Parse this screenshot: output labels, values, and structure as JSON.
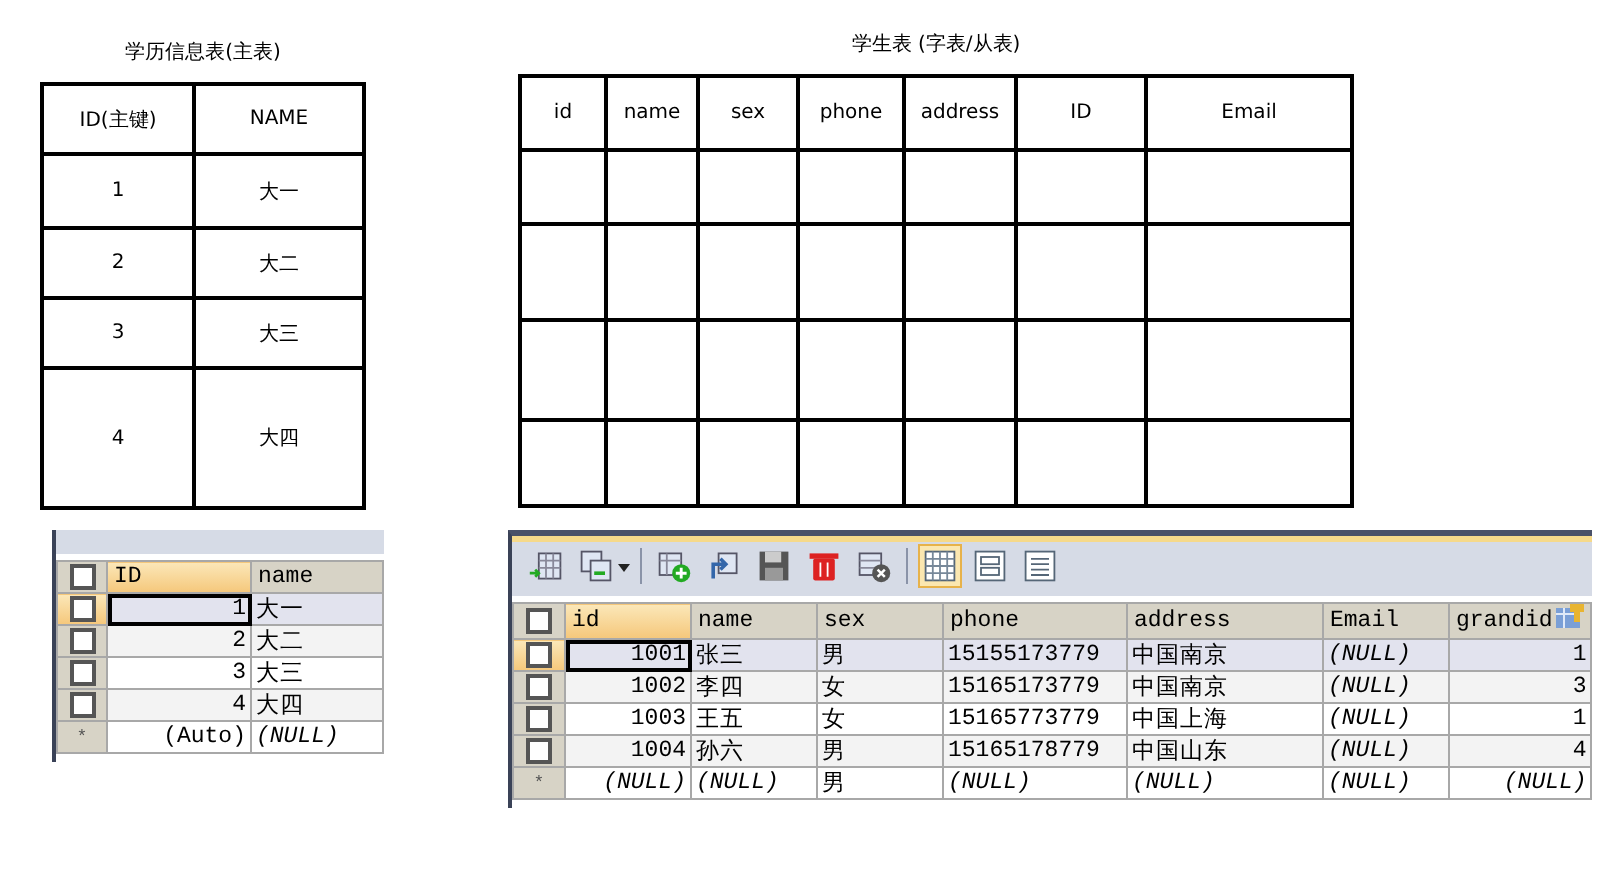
{
  "master_table": {
    "title": "学历信息表(主表)",
    "columns": [
      "ID(主键)",
      "NAME"
    ],
    "rows": [
      [
        "1",
        "大一"
      ],
      [
        "2",
        "大二"
      ],
      [
        "3",
        "大三"
      ],
      [
        "4",
        "大四"
      ]
    ]
  },
  "student_table": {
    "title": "学生表 (字表/从表)",
    "columns": [
      "id",
      "name",
      "sex",
      "phone",
      "address",
      "ID",
      "Email"
    ]
  },
  "master_grid": {
    "header_checked": false,
    "columns": [
      {
        "label": "ID",
        "kind": "number",
        "selected": true
      },
      {
        "label": "name",
        "kind": "text",
        "selected": false
      }
    ],
    "rows": [
      {
        "selected": true,
        "checked": false,
        "cells": [
          {
            "text": "1",
            "kind": "value"
          },
          {
            "text": "大一",
            "kind": "value"
          }
        ]
      },
      {
        "selected": false,
        "checked": false,
        "cells": [
          {
            "text": "2",
            "kind": "value"
          },
          {
            "text": "大二",
            "kind": "value"
          }
        ]
      },
      {
        "selected": false,
        "checked": false,
        "cells": [
          {
            "text": "3",
            "kind": "value"
          },
          {
            "text": "大三",
            "kind": "value"
          }
        ]
      },
      {
        "selected": false,
        "checked": false,
        "cells": [
          {
            "text": "4",
            "kind": "value"
          },
          {
            "text": "大四",
            "kind": "value"
          }
        ]
      }
    ],
    "new_row": {
      "marker": "*",
      "cells": [
        {
          "text": "(Auto)",
          "kind": "value"
        },
        {
          "text": "(NULL)",
          "kind": "null"
        }
      ]
    }
  },
  "student_grid": {
    "toolbar": [
      {
        "kind": "add-row"
      },
      {
        "kind": "duplicate",
        "menu": true
      },
      {
        "kind": "separator"
      },
      {
        "kind": "insert"
      },
      {
        "kind": "refresh"
      },
      {
        "kind": "save"
      },
      {
        "kind": "delete"
      },
      {
        "kind": "cancel"
      },
      {
        "kind": "separator"
      },
      {
        "kind": "grid-view",
        "selected": true
      },
      {
        "kind": "form-view",
        "selected": false
      },
      {
        "kind": "text-view",
        "selected": false
      }
    ],
    "header_checked": false,
    "columns": [
      {
        "label": "id",
        "kind": "number",
        "selected": true
      },
      {
        "label": "name",
        "kind": "text",
        "selected": false
      },
      {
        "label": "sex",
        "kind": "text",
        "selected": false
      },
      {
        "label": "phone",
        "kind": "text",
        "selected": false
      },
      {
        "label": "address",
        "kind": "text",
        "selected": false
      },
      {
        "label": "Email",
        "kind": "text",
        "selected": false
      },
      {
        "label": "grandid",
        "kind": "number",
        "selected": false,
        "key": true
      }
    ],
    "rows": [
      {
        "selected": true,
        "checked": false,
        "cells": [
          {
            "text": "1001",
            "kind": "value"
          },
          {
            "text": "张三",
            "kind": "value"
          },
          {
            "text": "男",
            "kind": "value"
          },
          {
            "text": "15155173779",
            "kind": "value"
          },
          {
            "text": "中国南京",
            "kind": "value"
          },
          {
            "text": "(NULL)",
            "kind": "null"
          },
          {
            "text": "1",
            "kind": "value"
          }
        ]
      },
      {
        "selected": false,
        "checked": false,
        "cells": [
          {
            "text": "1002",
            "kind": "value"
          },
          {
            "text": "李四",
            "kind": "value"
          },
          {
            "text": "女",
            "kind": "value"
          },
          {
            "text": "15165173779",
            "kind": "value"
          },
          {
            "text": "中国南京",
            "kind": "value"
          },
          {
            "text": "(NULL)",
            "kind": "null"
          },
          {
            "text": "3",
            "kind": "value"
          }
        ]
      },
      {
        "selected": false,
        "checked": false,
        "cells": [
          {
            "text": "1003",
            "kind": "value"
          },
          {
            "text": "王五",
            "kind": "value"
          },
          {
            "text": "女",
            "kind": "value"
          },
          {
            "text": "15165773779",
            "kind": "value"
          },
          {
            "text": "中国上海",
            "kind": "value"
          },
          {
            "text": "(NULL)",
            "kind": "null"
          },
          {
            "text": "1",
            "kind": "value"
          }
        ]
      },
      {
        "selected": false,
        "checked": false,
        "cells": [
          {
            "text": "1004",
            "kind": "value"
          },
          {
            "text": "孙六",
            "kind": "value"
          },
          {
            "text": "男",
            "kind": "value"
          },
          {
            "text": "15165178779",
            "kind": "value"
          },
          {
            "text": "中国山东",
            "kind": "value"
          },
          {
            "text": "(NULL)",
            "kind": "null"
          },
          {
            "text": "4",
            "kind": "value"
          }
        ]
      }
    ],
    "new_row": {
      "marker": "*",
      "cells": [
        {
          "text": "(NULL)",
          "kind": "null"
        },
        {
          "text": "(NULL)",
          "kind": "null"
        },
        {
          "text": "男",
          "kind": "value"
        },
        {
          "text": "(NULL)",
          "kind": "null"
        },
        {
          "text": "(NULL)",
          "kind": "null"
        },
        {
          "text": "(NULL)",
          "kind": "null"
        },
        {
          "text": "(NULL)",
          "kind": "null"
        }
      ]
    }
  }
}
